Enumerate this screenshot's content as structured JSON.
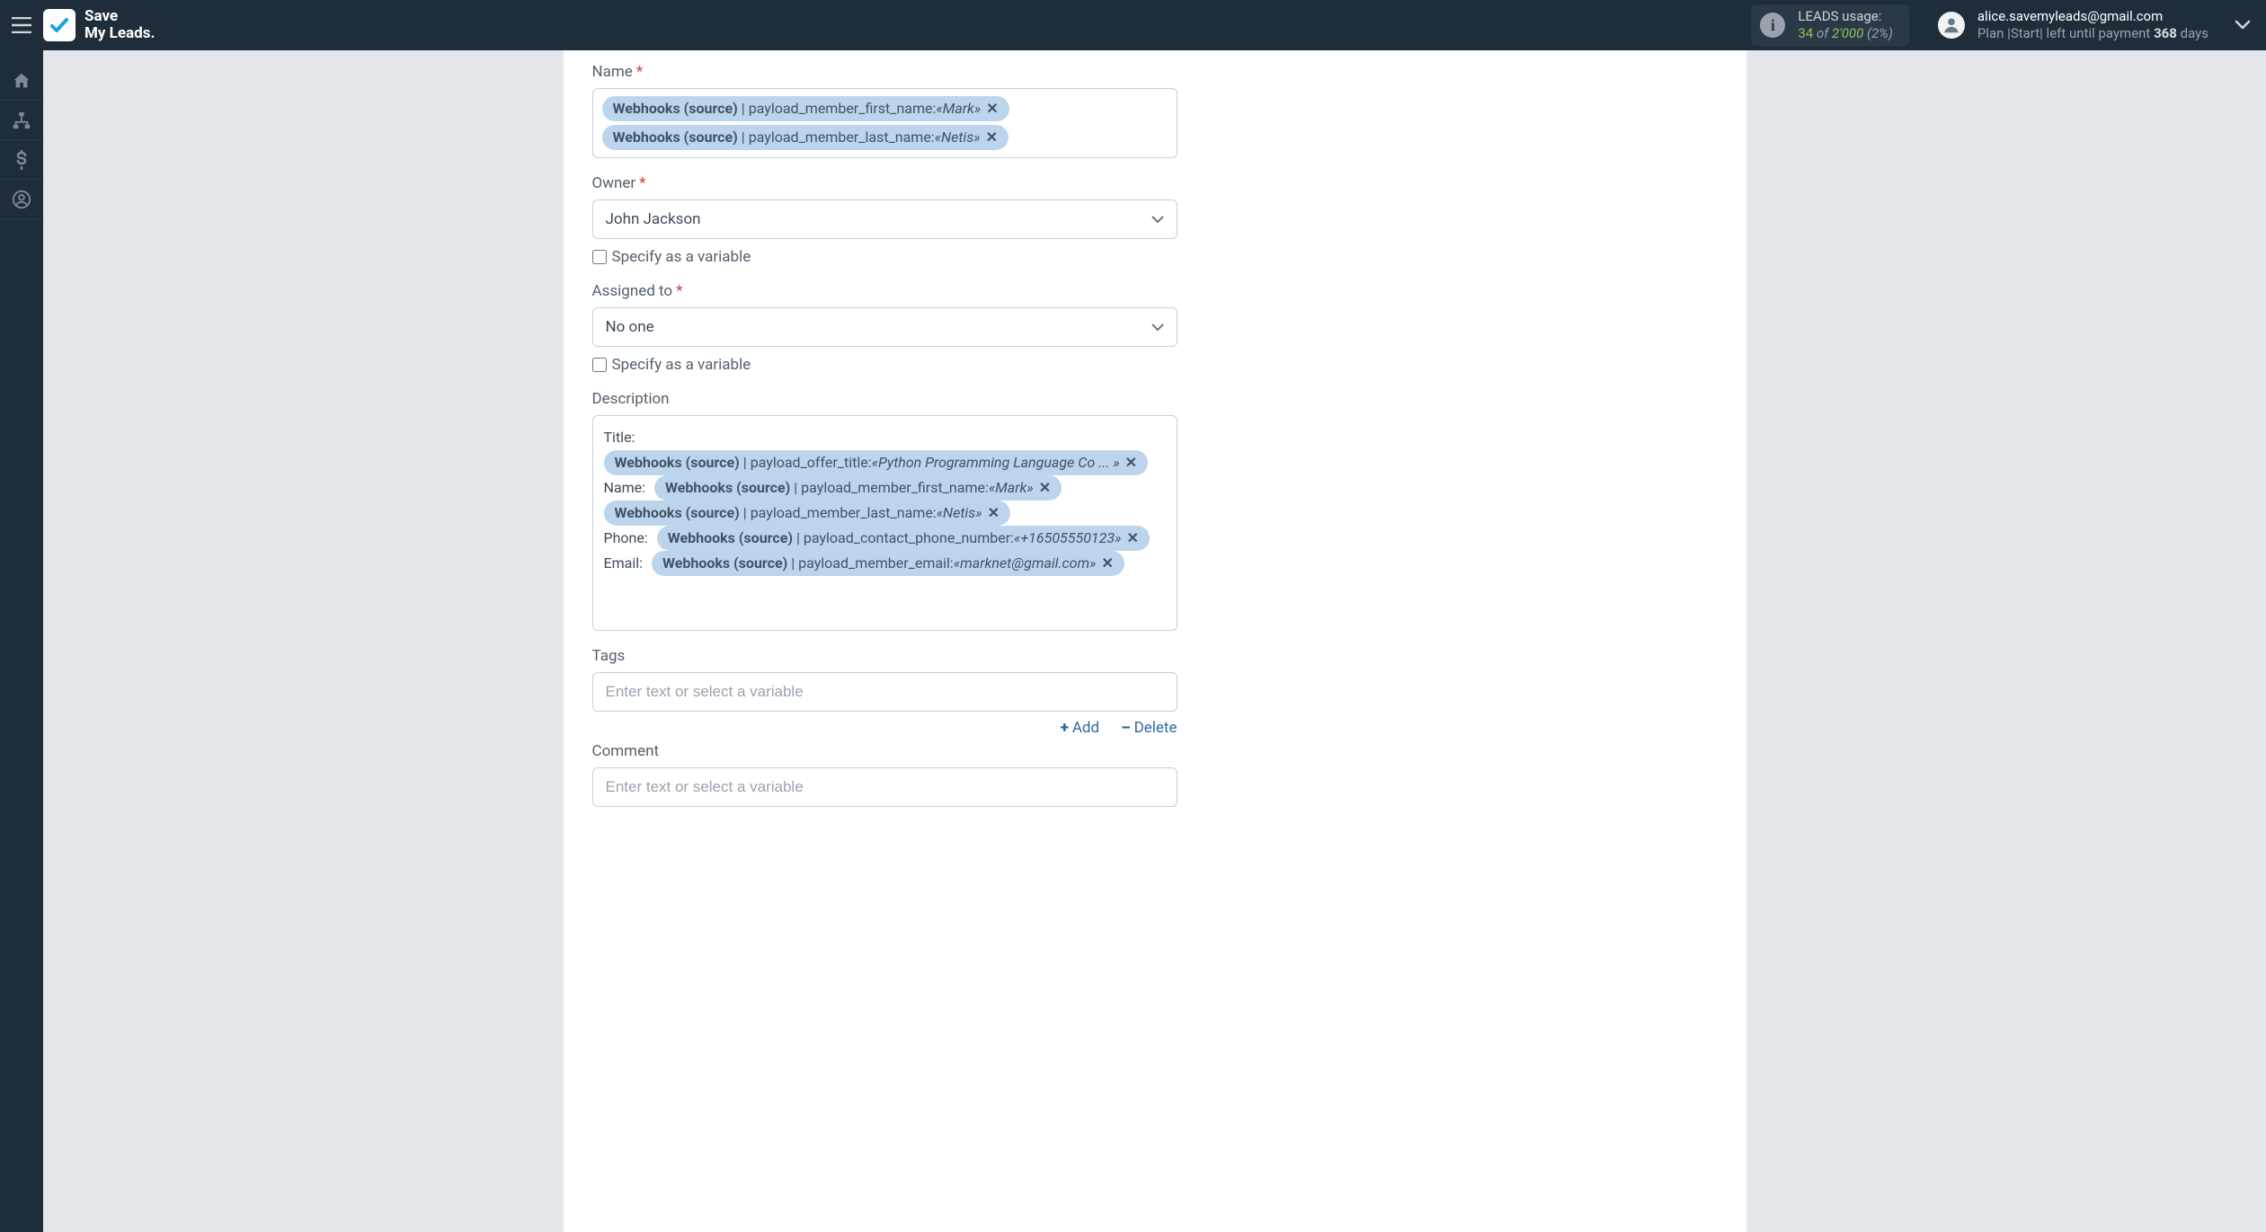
{
  "header": {
    "brand_line1": "Save",
    "brand_line2": "My Leads.",
    "usage": {
      "title": "LEADS usage:",
      "used": "34",
      "of_word": "of",
      "total": "2'000",
      "pct": "(2%)"
    },
    "account": {
      "email": "alice.savemyleads@gmail.com",
      "plan_prefix": "Plan |",
      "plan_name": "Start",
      "plan_suffix": "| left until payment",
      "days_num": "368",
      "days_word": "days"
    }
  },
  "form": {
    "name": {
      "label": "Name",
      "chips": [
        {
          "source": "Webhooks (source)",
          "key": "payload_member_first_name:",
          "value": "«Mark»"
        },
        {
          "source": "Webhooks (source)",
          "key": "payload_member_last_name:",
          "value": "«Netis»"
        }
      ]
    },
    "owner": {
      "label": "Owner",
      "value": "John Jackson",
      "specify_label": "Specify as a variable"
    },
    "assigned": {
      "label": "Assigned to",
      "value": "No one",
      "specify_label": "Specify as a variable"
    },
    "description": {
      "label": "Description",
      "rows": [
        {
          "prefix": "Title:",
          "chips": [
            {
              "source": "Webhooks (source)",
              "key": "payload_offer_title:",
              "value": "«Python Programming Language Co ... »"
            }
          ]
        },
        {
          "prefix": "Name:",
          "chips": [
            {
              "source": "Webhooks (source)",
              "key": "payload_member_first_name:",
              "value": "«Mark»"
            },
            {
              "source": "Webhooks (source)",
              "key": "payload_member_last_name:",
              "value": "«Netis»"
            }
          ]
        },
        {
          "prefix": "Phone:",
          "chips": [
            {
              "source": "Webhooks (source)",
              "key": "payload_contact_phone_number:",
              "value": "«+16505550123»"
            }
          ]
        },
        {
          "prefix": "Email:",
          "chips": [
            {
              "source": "Webhooks (source)",
              "key": "payload_member_email:",
              "value": "«marknet@gmail.com»"
            }
          ]
        }
      ]
    },
    "tags": {
      "label": "Tags",
      "placeholder": "Enter text or select a variable",
      "add_label": "Add",
      "delete_label": "Delete"
    },
    "comment": {
      "label": "Comment",
      "placeholder": "Enter text or select a variable"
    }
  }
}
